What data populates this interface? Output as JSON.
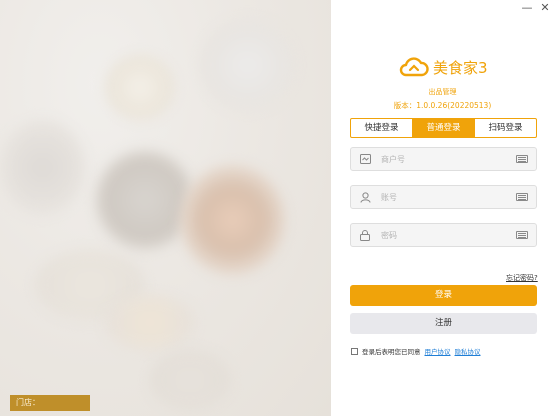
{
  "left": {
    "store_label": "门店："
  },
  "window": {
    "minimize_glyph": "—",
    "close_glyph": "✕"
  },
  "brand": {
    "name": "美食家3",
    "subtitle": "出品管理",
    "version": "版本：1.0.0.26(20220513)",
    "accent_color": "#f0a30a"
  },
  "tabs": [
    {
      "label": "快捷登录",
      "active": false
    },
    {
      "label": "普通登录",
      "active": true
    },
    {
      "label": "扫码登录",
      "active": false
    }
  ],
  "form": {
    "merchant_placeholder": "商户号",
    "account_placeholder": "账号",
    "password_placeholder": "密码",
    "merchant_icon": "storefront-icon",
    "account_icon": "user-icon",
    "password_icon": "lock-icon",
    "keyboard_icon": "keyboard-icon"
  },
  "actions": {
    "forgot_password": "忘记密码?",
    "login": "登录",
    "register": "注册"
  },
  "agreement": {
    "text": "登录后表明您已同意",
    "user_agreement": "用户协议",
    "privacy_policy": "隐私协议",
    "checked": false
  }
}
